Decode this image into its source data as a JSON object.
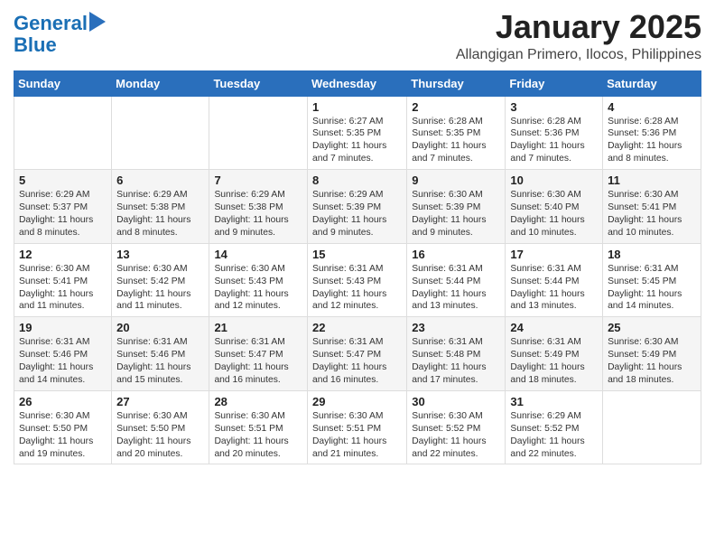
{
  "header": {
    "logo_line1": "General",
    "logo_line2": "Blue",
    "month": "January 2025",
    "location": "Allangigan Primero, Ilocos, Philippines"
  },
  "weekdays": [
    "Sunday",
    "Monday",
    "Tuesday",
    "Wednesday",
    "Thursday",
    "Friday",
    "Saturday"
  ],
  "weeks": [
    [
      {
        "day": "",
        "text": ""
      },
      {
        "day": "",
        "text": ""
      },
      {
        "day": "",
        "text": ""
      },
      {
        "day": "1",
        "text": "Sunrise: 6:27 AM\nSunset: 5:35 PM\nDaylight: 11 hours and 7 minutes."
      },
      {
        "day": "2",
        "text": "Sunrise: 6:28 AM\nSunset: 5:35 PM\nDaylight: 11 hours and 7 minutes."
      },
      {
        "day": "3",
        "text": "Sunrise: 6:28 AM\nSunset: 5:36 PM\nDaylight: 11 hours and 7 minutes."
      },
      {
        "day": "4",
        "text": "Sunrise: 6:28 AM\nSunset: 5:36 PM\nDaylight: 11 hours and 8 minutes."
      }
    ],
    [
      {
        "day": "5",
        "text": "Sunrise: 6:29 AM\nSunset: 5:37 PM\nDaylight: 11 hours and 8 minutes."
      },
      {
        "day": "6",
        "text": "Sunrise: 6:29 AM\nSunset: 5:38 PM\nDaylight: 11 hours and 8 minutes."
      },
      {
        "day": "7",
        "text": "Sunrise: 6:29 AM\nSunset: 5:38 PM\nDaylight: 11 hours and 9 minutes."
      },
      {
        "day": "8",
        "text": "Sunrise: 6:29 AM\nSunset: 5:39 PM\nDaylight: 11 hours and 9 minutes."
      },
      {
        "day": "9",
        "text": "Sunrise: 6:30 AM\nSunset: 5:39 PM\nDaylight: 11 hours and 9 minutes."
      },
      {
        "day": "10",
        "text": "Sunrise: 6:30 AM\nSunset: 5:40 PM\nDaylight: 11 hours and 10 minutes."
      },
      {
        "day": "11",
        "text": "Sunrise: 6:30 AM\nSunset: 5:41 PM\nDaylight: 11 hours and 10 minutes."
      }
    ],
    [
      {
        "day": "12",
        "text": "Sunrise: 6:30 AM\nSunset: 5:41 PM\nDaylight: 11 hours and 11 minutes."
      },
      {
        "day": "13",
        "text": "Sunrise: 6:30 AM\nSunset: 5:42 PM\nDaylight: 11 hours and 11 minutes."
      },
      {
        "day": "14",
        "text": "Sunrise: 6:30 AM\nSunset: 5:43 PM\nDaylight: 11 hours and 12 minutes."
      },
      {
        "day": "15",
        "text": "Sunrise: 6:31 AM\nSunset: 5:43 PM\nDaylight: 11 hours and 12 minutes."
      },
      {
        "day": "16",
        "text": "Sunrise: 6:31 AM\nSunset: 5:44 PM\nDaylight: 11 hours and 13 minutes."
      },
      {
        "day": "17",
        "text": "Sunrise: 6:31 AM\nSunset: 5:44 PM\nDaylight: 11 hours and 13 minutes."
      },
      {
        "day": "18",
        "text": "Sunrise: 6:31 AM\nSunset: 5:45 PM\nDaylight: 11 hours and 14 minutes."
      }
    ],
    [
      {
        "day": "19",
        "text": "Sunrise: 6:31 AM\nSunset: 5:46 PM\nDaylight: 11 hours and 14 minutes."
      },
      {
        "day": "20",
        "text": "Sunrise: 6:31 AM\nSunset: 5:46 PM\nDaylight: 11 hours and 15 minutes."
      },
      {
        "day": "21",
        "text": "Sunrise: 6:31 AM\nSunset: 5:47 PM\nDaylight: 11 hours and 16 minutes."
      },
      {
        "day": "22",
        "text": "Sunrise: 6:31 AM\nSunset: 5:47 PM\nDaylight: 11 hours and 16 minutes."
      },
      {
        "day": "23",
        "text": "Sunrise: 6:31 AM\nSunset: 5:48 PM\nDaylight: 11 hours and 17 minutes."
      },
      {
        "day": "24",
        "text": "Sunrise: 6:31 AM\nSunset: 5:49 PM\nDaylight: 11 hours and 18 minutes."
      },
      {
        "day": "25",
        "text": "Sunrise: 6:30 AM\nSunset: 5:49 PM\nDaylight: 11 hours and 18 minutes."
      }
    ],
    [
      {
        "day": "26",
        "text": "Sunrise: 6:30 AM\nSunset: 5:50 PM\nDaylight: 11 hours and 19 minutes."
      },
      {
        "day": "27",
        "text": "Sunrise: 6:30 AM\nSunset: 5:50 PM\nDaylight: 11 hours and 20 minutes."
      },
      {
        "day": "28",
        "text": "Sunrise: 6:30 AM\nSunset: 5:51 PM\nDaylight: 11 hours and 20 minutes."
      },
      {
        "day": "29",
        "text": "Sunrise: 6:30 AM\nSunset: 5:51 PM\nDaylight: 11 hours and 21 minutes."
      },
      {
        "day": "30",
        "text": "Sunrise: 6:30 AM\nSunset: 5:52 PM\nDaylight: 11 hours and 22 minutes."
      },
      {
        "day": "31",
        "text": "Sunrise: 6:29 AM\nSunset: 5:52 PM\nDaylight: 11 hours and 22 minutes."
      },
      {
        "day": "",
        "text": ""
      }
    ]
  ]
}
